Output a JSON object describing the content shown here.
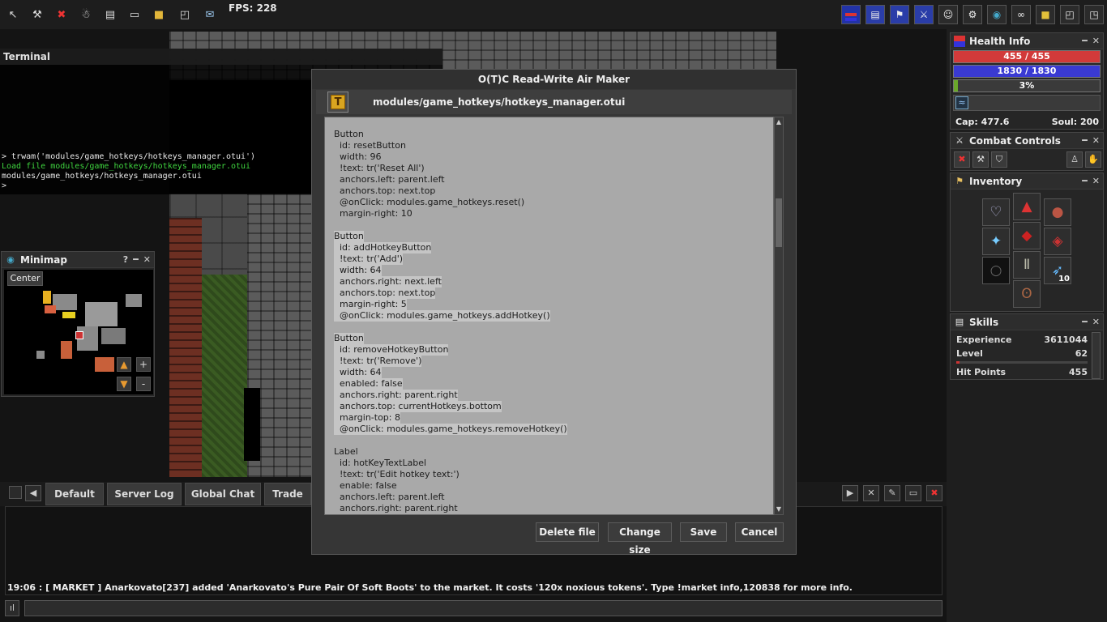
{
  "topbar": {
    "fps": "FPS: 228",
    "left_icons": [
      "cursor-icon",
      "wrench-icon",
      "logout-icon",
      "character-icon",
      "notes-icon",
      "terminal-icon",
      "module-icon",
      "window-icon",
      "scroll-icon"
    ],
    "right_icons": [
      "health-bar-icon",
      "skills-icon",
      "battle-icon",
      "combat-icon",
      "party-icon",
      "options-icon",
      "world-icon",
      "links-icon",
      "stash-icon",
      "minimize-icon",
      "maximize-icon"
    ]
  },
  "terminal": {
    "title": "Terminal",
    "lines": [
      "> trwam('modules/game_hotkeys/hotkeys_manager.otui')",
      "Load file modules/game_hotkeys/hotkeys_manager.otui",
      "modules/game_hotkeys/hotkeys_manager.otui",
      ">"
    ]
  },
  "minimap": {
    "title": "Minimap",
    "help": "?",
    "center": "Center",
    "zoom_in": "+",
    "zoom_out": "-"
  },
  "dialog": {
    "title": "O(T)C Read-Write Air Maker",
    "icon_letter": "T",
    "path": "modules/game_hotkeys/hotkeys_manager.otui",
    "code": [
      "",
      "Button",
      "  id: resetButton",
      "  width: 96",
      "  !text: tr('Reset All')",
      "  anchors.left: parent.left",
      "  anchors.top: next.top",
      "  @onClick: modules.game_hotkeys.reset()",
      "  margin-right: 10",
      "",
      "Button",
      "  id: addHotkeyButton",
      "  !text: tr('Add')",
      "  width: 64",
      "  anchors.right: next.left",
      "  anchors.top: next.top",
      "  margin-right: 5",
      "  @onClick: modules.game_hotkeys.addHotkey()",
      "",
      "Button",
      "  id: removeHotkeyButton",
      "  !text: tr('Remove')",
      "  width: 64",
      "  enabled: false",
      "  anchors.right: parent.right",
      "  anchors.top: currentHotkeys.bottom",
      "  margin-top: 8",
      "  @onClick: modules.game_hotkeys.removeHotkey()",
      "",
      "Label",
      "  id: hotKeyTextLabel",
      "  !text: tr('Edit hotkey text:')",
      "  enable: false",
      "  anchors.left: parent.left",
      "  anchors.right: parent.right"
    ],
    "buttons": {
      "delete": "Delete file",
      "change_size": "Change size",
      "save": "Save",
      "cancel": "Cancel"
    }
  },
  "chat": {
    "tabs": [
      "Default",
      "Server Log",
      "Global Chat",
      "Trade"
    ],
    "message": "19:06 : [ MARKET ] Anarkovato[237] added 'Anarkovato's Pure Pair Of Soft Boots' to the market. It costs '120x noxious tokens'. Type !market info,120838 for more info."
  },
  "health": {
    "title": "Health Info",
    "hp": "455 / 455",
    "mana": "1830 / 1830",
    "exp_percent_label": "3%",
    "exp_fraction": 0.03,
    "cap": "Cap: 477.6",
    "soul": "Soul: 200",
    "colors": {
      "hp": "#d23a3a",
      "mana": "#3a3ad2",
      "exp": "#6aa82a"
    }
  },
  "combat": {
    "title": "Combat Controls"
  },
  "inventory": {
    "title": "Inventory",
    "ammo_count": "10"
  },
  "skills": {
    "title": "Skills",
    "rows": [
      {
        "label": "Experience",
        "value": "3611044"
      },
      {
        "label": "Level",
        "value": "62"
      },
      {
        "label": "Hit Points",
        "value": "455"
      }
    ]
  }
}
